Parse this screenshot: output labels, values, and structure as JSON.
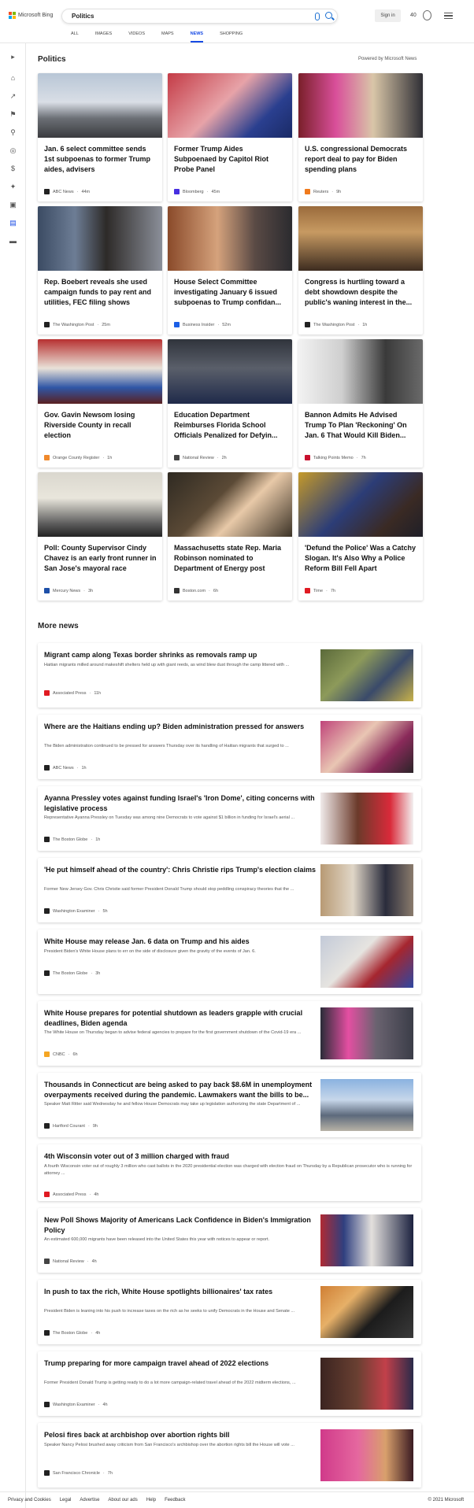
{
  "brand": {
    "name": "Microsoft Bing"
  },
  "search": {
    "query": "Politics"
  },
  "header": {
    "signin": "Sign in",
    "points": "40"
  },
  "tabs": [
    "ALL",
    "IMAGES",
    "VIDEOS",
    "MAPS",
    "NEWS",
    "SHOPPING"
  ],
  "active_tab": "NEWS",
  "section": {
    "title": "Politics",
    "powered": "Powered by Microsoft News"
  },
  "cards": [
    {
      "title": "Jan. 6 select committee sends 1st subpoenas to former Trump aides, advisers",
      "source": "ABC News",
      "time": "44m",
      "icon_color": "#222222",
      "img": "capitol"
    },
    {
      "title": "Former Trump Aides Subpoenaed by Capitol Riot Probe Panel",
      "source": "Bloomberg",
      "time": "45m",
      "icon_color": "#472fe0",
      "img": "flags"
    },
    {
      "title": "U.S. congressional Democrats report deal to pay for Biden spending plans",
      "source": "Reuters",
      "time": "9h",
      "icon_color": "#f07a1c",
      "img": "pelosi"
    },
    {
      "title": "Rep. Boebert reveals she used campaign funds to pay rent and utilities, FEC filing shows",
      "source": "The Washington Post",
      "time": "25m",
      "icon_color": "#222222",
      "img": "boebert"
    },
    {
      "title": "House Select Committee investigating January 6 issued subpoenas to Trump confidan...",
      "source": "Business Insider",
      "time": "52m",
      "icon_color": "#1b5fe6",
      "img": "trump-bannon"
    },
    {
      "title": "Congress is hurtling toward a debt showdown despite the public's waning interest in the...",
      "source": "The Washington Post",
      "time": "1h",
      "icon_color": "#222222",
      "img": "hallway"
    },
    {
      "title": "Gov. Gavin Newsom losing Riverside County in recall election",
      "source": "Orange County Register",
      "time": "1h",
      "icon_color": "#f0892c",
      "img": "recall"
    },
    {
      "title": "Education Department Reimburses Florida School Officials Penalized for Defyin...",
      "source": "National Review",
      "time": "2h",
      "icon_color": "#444444",
      "img": "classroom"
    },
    {
      "title": "Bannon Admits He Advised Trump To Plan 'Reckoning' On Jan. 6 That Would Kill Biden...",
      "source": "Talking Points Memo",
      "time": "7h",
      "icon_color": "#c8102e",
      "img": "bannon"
    },
    {
      "title": "Poll: County Supervisor Cindy Chavez is an early front runner in San Jose's mayoral race",
      "source": "Mercury News",
      "time": "3h",
      "icon_color": "#1d4fa8",
      "img": "chavez"
    },
    {
      "title": "Massachusetts state Rep. Maria Robinson nominated to Department of Energy post",
      "source": "Boston.com",
      "time": "6h",
      "icon_color": "#333333",
      "img": "robinson"
    },
    {
      "title": "'Defund the Police' Was a Catchy Slogan. It's Also Why a Police Reform Bill Fell Apart",
      "source": "Time",
      "time": "7h",
      "icon_color": "#e01a22",
      "img": "congress"
    }
  ],
  "more": {
    "title": "More news"
  },
  "rows": [
    {
      "title": "Migrant camp along Texas border shrinks as removals ramp up",
      "desc": "Haitian migrants milled around makeshift shelters held up with giant reeds, as wind blew dust through the camp littered with ...",
      "source": "Associated Press",
      "time": "11h",
      "icon_color": "#e01a22",
      "img": "camp"
    },
    {
      "title": "Where are the Haitians ending up? Biden administration pressed for answers",
      "desc": "The Biden administration continued to be pressed for answers Thursday over its handling of Haitian migrants that surged to ...",
      "source": "ABC News",
      "time": "1h",
      "icon_color": "#222222",
      "img": "haiti"
    },
    {
      "title": "Ayanna Pressley votes against funding Israel's 'Iron Dome', citing concerns with legislative process",
      "desc": "Representative Ayanna Pressley on Tuesday was among nine Democrats to vote against $1 billion in funding for Israel's aerial ...",
      "source": "The Boston Globe",
      "time": "1h",
      "icon_color": "#222222",
      "img": "pressley"
    },
    {
      "title": "'He put himself ahead of the country': Chris Christie rips Trump's election claims",
      "desc": "Former New Jersey Gov. Chris Christie said former President Donald Trump should stop peddling conspiracy theories that the ...",
      "source": "Washington Examiner",
      "time": "5h",
      "icon_color": "#222222",
      "img": "christie"
    },
    {
      "title": "White House may release Jan. 6 data on Trump and his aides",
      "desc": "President Biden's White House plans to err on the side of disclosure given the gravity of the events of Jan. 6.",
      "source": "The Boston Globe",
      "time": "3h",
      "icon_color": "#222222",
      "img": "capitol2"
    },
    {
      "title": "White House prepares for potential shutdown as leaders grapple with crucial deadlines, Biden agenda",
      "desc": "The White House on Thursday began to advise federal agencies to prepare for the first government shutdown of the Covid-19 era ...",
      "source": "CNBC",
      "time": "6h",
      "icon_color": "#f5a623",
      "img": "pelosi2"
    },
    {
      "title": "Thousands in Connecticut are being asked to pay back $8.6M in unemployment overpayments received during the pandemic. Lawmakers want the bills to be...",
      "desc": "Speaker Matt Ritter said Wednesday he and fellow House Democrats may take up legislation authorizing the state Department of ...",
      "source": "Hartford Courant",
      "time": "9h",
      "icon_color": "#222222",
      "img": "building"
    },
    {
      "title": "4th Wisconsin voter out of 3 million charged with fraud",
      "desc": "A fourth Wisconsin voter out of roughly 3 million who cast ballots in the 2020 presidential election was charged with election fraud on Thursday by a Republican prosecutor who is running for attorney ...",
      "source": "Associated Press",
      "time": "4h",
      "icon_color": "#e01a22",
      "img": ""
    },
    {
      "title": "New Poll Shows Majority of Americans Lack Confidence in Biden's Immigration Policy",
      "desc": "An estimated 600,000 migrants have been released into the United States this year with notices to appear or report.",
      "source": "National Review",
      "time": "4h",
      "icon_color": "#444444",
      "img": "biden"
    },
    {
      "title": "In push to tax the rich, White House spotlights billionaires' tax rates",
      "desc": "President Biden is leaning into his push to increase taxes on the rich as he seeks to unify Democrats in the House and Senate ...",
      "source": "The Boston Globe",
      "time": "4h",
      "icon_color": "#222222",
      "img": "taxme"
    },
    {
      "title": "Trump preparing for more campaign travel ahead of 2022 elections",
      "desc": "Former President Donald Trump is getting ready to do a lot more campaign-related travel ahead of the 2022 midterm elections, ...",
      "source": "Washington Examiner",
      "time": "4h",
      "icon_color": "#222222",
      "img": "trump2"
    },
    {
      "title": "Pelosi fires back at archbishop over abortion rights bill",
      "desc": "Speaker Nancy Pelosi brushed away criticism from San Francisco's archbishop over the abortion rights bill the House will vote ...",
      "source": "San Francisco Chronicle",
      "time": "7h",
      "icon_color": "#222222",
      "img": "pelosi3"
    }
  ],
  "footer": {
    "links": [
      "Privacy and Cookies",
      "Legal",
      "Advertise",
      "About our ads",
      "Help",
      "Feedback"
    ],
    "copyright": "© 2021 Microsoft"
  }
}
